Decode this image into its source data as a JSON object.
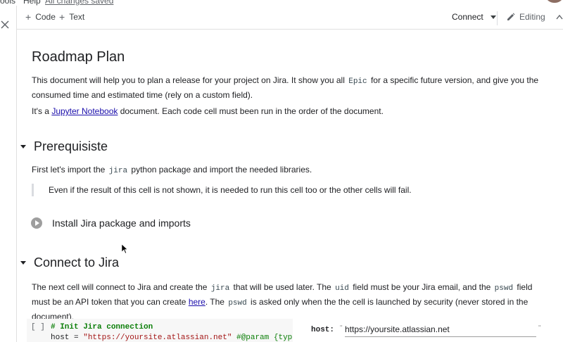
{
  "menubar": {
    "tools": "Tools",
    "help": "Help",
    "saved_status": "All changes saved"
  },
  "toolbar": {
    "add_code": "Code",
    "add_text": "Text",
    "connect": "Connect",
    "editing": "Editing"
  },
  "doc": {
    "title": "Roadmap Plan",
    "intro_a": "This document will help you to plan a release for your project on Jira. It show you all ",
    "intro_code": "Epic",
    "intro_b": " for a specific future version, and give you the consumed time and estimated time (rely on a custom field).",
    "notebook_a": "It's a ",
    "notebook_link": "Jupyter Notebook",
    "notebook_b": " document. Each code cell must been run in the order of the document."
  },
  "prereq": {
    "heading": "Prerequisiste",
    "text_a": "First let's import the ",
    "text_code": "jira",
    "text_b": " python package and import the needed libraries.",
    "note": "Even if the result of this cell is not shown, it is needed to run this cell too or the other cells will fail.",
    "cell_label": "Install Jira package and imports"
  },
  "connect_section": {
    "heading": "Connect to Jira",
    "p1": "The next cell will connect to Jira and create the ",
    "p1_code": "jira",
    "p2": " that will be used later. The ",
    "p2_code": "uid",
    "p3": " field must be your Jira email, and the ",
    "p3_code": "pswd",
    "p4": " field must be an API token that you can create ",
    "p4_link": "here",
    "p5": ". The ",
    "p5_code": "pswd",
    "p6": " is asked only when the the cell is launched by security (never stored in the document)."
  },
  "code_cell": {
    "bracket": "[ ]",
    "line1": "# Init Jira connection",
    "line2_a": "host = ",
    "line2_str": "\"https://yoursite.atlassian.net\"",
    "line2_b": " #@param {type:\"st"
  },
  "form": {
    "host_label": "host:",
    "host_value": "https://yoursite.atlassian.net"
  }
}
